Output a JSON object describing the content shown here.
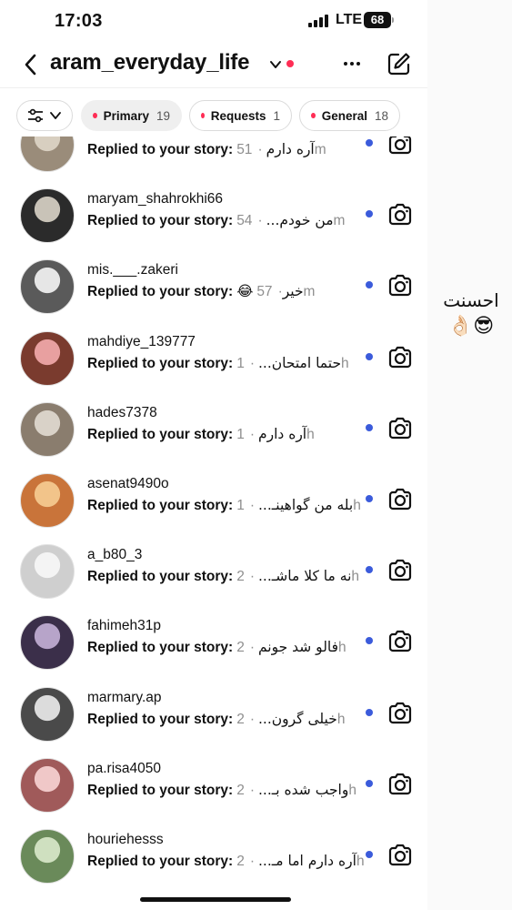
{
  "status": {
    "time": "17:03",
    "network": "LTE",
    "battery": "68"
  },
  "header": {
    "username": "aram_everyday_life"
  },
  "chips": {
    "primary_label": "Primary",
    "primary_count": "19",
    "requests_label": "Requests",
    "requests_count": "1",
    "general_label": "General",
    "general_count": "18"
  },
  "conversations": [
    {
      "username": "",
      "preview": "Replied to your story:",
      "message": "آره دارم",
      "time": "51m",
      "unread": true
    },
    {
      "username": "maryam_shahrokhi66",
      "preview": "Replied to your story:",
      "message": "من خودم...",
      "time": "54m",
      "unread": true
    },
    {
      "username": "mis.___.zakeri",
      "preview": "Replied to your story:",
      "message": "😂خیر",
      "time": "57m",
      "unread": true
    },
    {
      "username": "mahdiye_139777",
      "preview": "Replied to your story:",
      "message": "حتما امتحان...",
      "time": "1h",
      "unread": true
    },
    {
      "username": "hades7378",
      "preview": "Replied to your story:",
      "message": "آره دارم",
      "time": "1h",
      "unread": true
    },
    {
      "username": "asenat9490o",
      "preview": "Replied to your story:",
      "message": "بله من گواهینـ...",
      "time": "1h",
      "unread": true
    },
    {
      "username": "a_b80_3",
      "preview": "Replied to your story:",
      "message": "نه ما کلا ماشـ...",
      "time": "2h",
      "unread": true
    },
    {
      "username": "fahimeh31p",
      "preview": "Replied to your story:",
      "message": "فالو شد جونم",
      "time": "2h",
      "unread": true
    },
    {
      "username": "marmary.ap",
      "preview": "Replied to your story:",
      "message": "خیلی گرون...",
      "time": "2h",
      "unread": true
    },
    {
      "username": "pa.risa4050",
      "preview": "Replied to your story:",
      "message": "واجب شده بـ...",
      "time": "2h",
      "unread": true
    },
    {
      "username": "houriehesss",
      "preview": "Replied to your story:",
      "message": "آره دارم اما مـ...",
      "time": "2h",
      "unread": true
    }
  ],
  "side_note": {
    "text": "احسنت",
    "emoji": "👌🏻😎"
  },
  "colors": {
    "unread_dot": "#3b5bdb",
    "notification_dot": "#ff2d55"
  },
  "icons": [
    "back-arrow-icon",
    "chevron-down-icon",
    "more-icon",
    "compose-icon",
    "filter-icon",
    "camera-icon"
  ]
}
